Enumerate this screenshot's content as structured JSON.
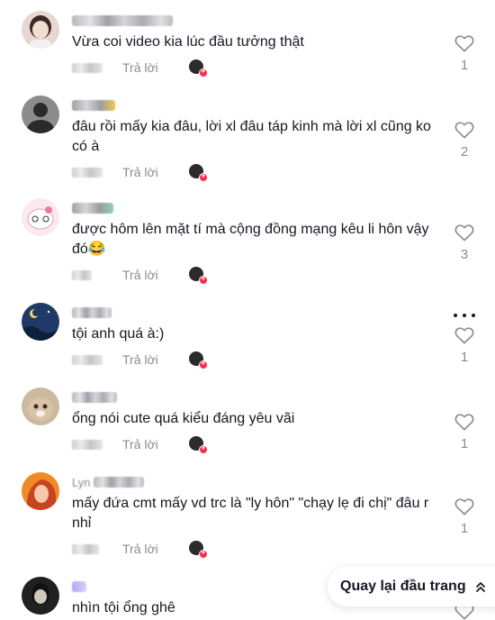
{
  "reply_label": "Trả lời",
  "back_to_top_label": "Quay lại đầu trang",
  "colors": {
    "creator_badge": "#fe2c55",
    "secondary_text": "#8a8b91",
    "primary_text": "#161823"
  },
  "comments": [
    {
      "username_suffix": "",
      "text": "Vừa coi video kia lúc đầu tưởng thật",
      "likes": "1"
    },
    {
      "username_suffix": "",
      "text": "đâu rồi mấy kia đâu, lời xl đâu táp kinh mà lời xl cũng ko có à",
      "likes": "2"
    },
    {
      "username_suffix": "",
      "text": "được hôm lên mặt tí mà cộng đồng mạng kêu li hôn vậy đó😂",
      "likes": "3"
    },
    {
      "username_suffix": "",
      "text": "tội anh quá à:)",
      "likes": "1"
    },
    {
      "username_suffix": "",
      "text": "ổng nói cute quá kiểu đáng yêu vãi",
      "likes": "1"
    },
    {
      "username_suffix": "Lyn",
      "text": "mấy đứa cmt mấy vd trc là \"ly hôn\" \"chạy lẹ đi chị\" đâu r nhỉ",
      "likes": "1"
    },
    {
      "username_suffix": "",
      "text": "nhìn tội ổng ghê",
      "likes": ""
    }
  ]
}
